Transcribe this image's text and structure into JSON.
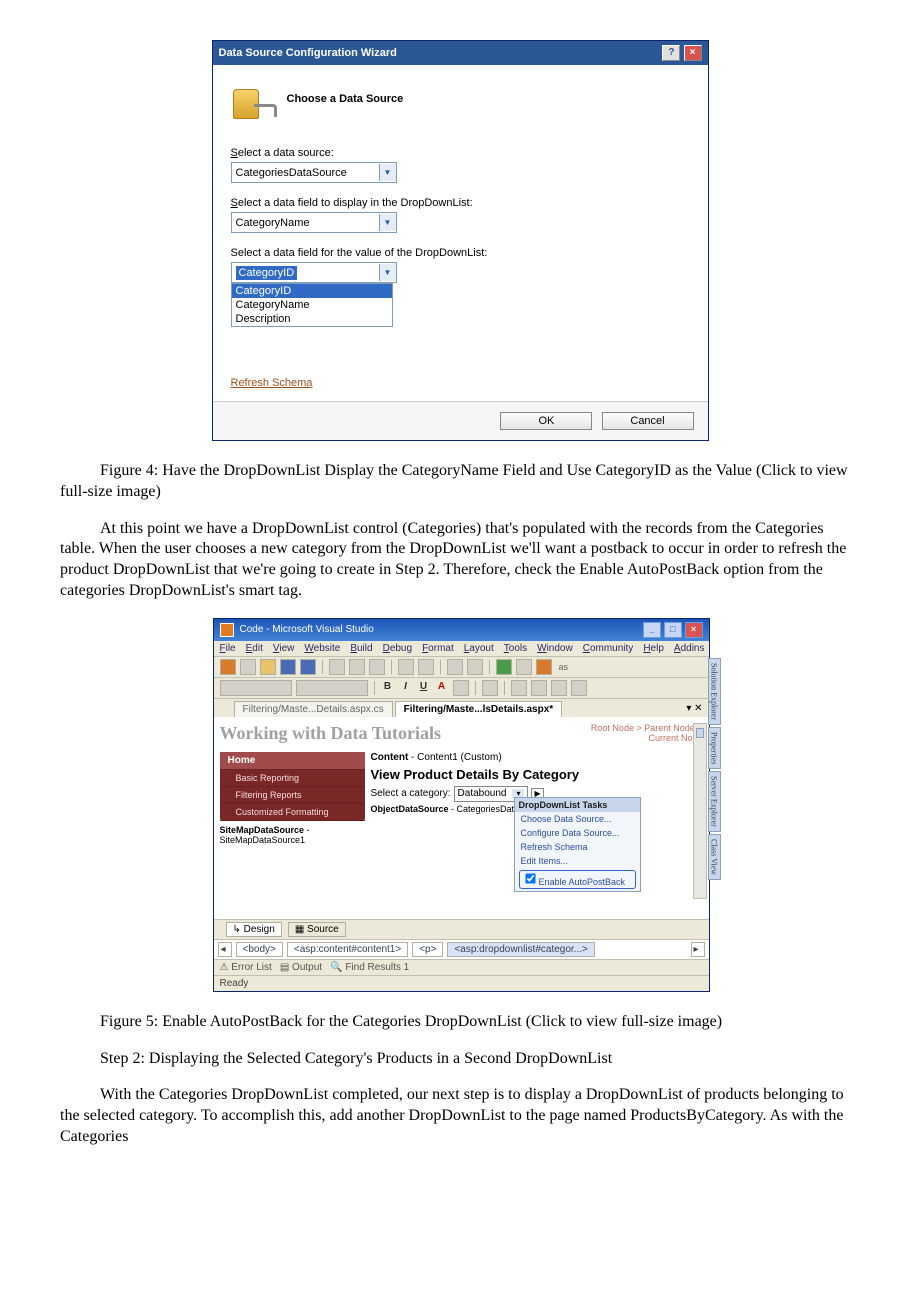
{
  "fig4": {
    "title": "Data Source Configuration Wizard",
    "heading": "Choose a Data Source",
    "label1_pre": "S",
    "label1_rest": "elect a data source:",
    "combo1": "CategoriesDataSource",
    "label2_pre": "S",
    "label2_rest": "elect a data field to display in the DropDownList:",
    "combo2": "CategoryName",
    "label3": "Select a data field for the value of the DropDownList:",
    "combo3_sel": "CategoryID",
    "combo3_options": [
      "CategoryID",
      "CategoryName",
      "Description"
    ],
    "refresh": "Refresh Schema",
    "ok": "OK",
    "cancel": "Cancel"
  },
  "caption4": "Figure 4: Have the DropDownList Display the CategoryName Field and Use CategoryID as the Value (Click to view full-size image)",
  "para1": "At this point we have a DropDownList control (Categories) that's populated with the records from the Categories table. When the user chooses a new category from the DropDownList we'll want a postback to occur in order to refresh the product DropDownList that we're going to create in Step 2. Therefore, check the Enable AutoPostBack option from the categories DropDownList's smart tag.",
  "fig5": {
    "title": "Code - Microsoft Visual Studio",
    "menus": [
      "File",
      "Edit",
      "View",
      "Website",
      "Build",
      "Debug",
      "Format",
      "Layout",
      "Tools",
      "Window",
      "Community",
      "Help",
      "Addins"
    ],
    "tab1": "Filtering/Maste...Details.aspx.cs",
    "tab2": "Filtering/Maste...lsDetails.aspx*",
    "heading": "Working with Data Tutorials",
    "bc": "Root Node > Parent Node >\nCurrent Node",
    "nav": {
      "home": "Home",
      "items": [
        "Basic Reporting",
        "Filtering Reports",
        "Customized Formatting"
      ]
    },
    "smds_pre": "SiteMapDataSource",
    "smds_rest": " - SiteMapDataSource1",
    "content_caption_pre": "Content",
    "content_caption_rest": " - Content1 (Custom)",
    "content_title": "View Product Details By Category",
    "selcat_label": "Select a category: ",
    "databound": "Databound",
    "ods_caption_pre": "ObjectDataSource",
    "ods_caption_rest": " - CategoriesDataSource",
    "smart_tag": {
      "title": "DropDownList Tasks",
      "items": [
        "Choose Data Source...",
        "Configure Data Source...",
        "Refresh Schema",
        "Edit Items..."
      ],
      "checkbox": "Enable AutoPostBack"
    },
    "bottom_tabs": {
      "design": "Design",
      "source": "Source"
    },
    "bc_bar": [
      "<body>",
      "<asp:content#content1>",
      "<p>",
      "<asp:dropdownlist#categor...>"
    ],
    "err_bar": [
      "Error List",
      "Output",
      "Find Results 1"
    ],
    "status": "Ready",
    "side_tabs": [
      "Solution Explorer",
      "Properties",
      "Server Explorer",
      "Class View"
    ]
  },
  "caption5": "Figure 5: Enable AutoPostBack for the Categories DropDownList (Click to view full-size image)",
  "step2": "Step 2: Displaying the Selected Category's Products in a Second DropDownList",
  "para2": "With the Categories DropDownList completed, our next step is to display a DropDownList of products belonging to the selected category. To accomplish this, add another DropDownList to the page named ProductsByCategory. As with the Categories"
}
